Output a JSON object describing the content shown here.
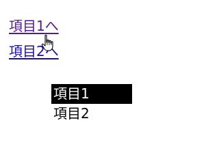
{
  "links": [
    {
      "label": "項目1へ",
      "state": "visited"
    },
    {
      "label": "項目2へ",
      "state": "unvisited"
    }
  ],
  "list": {
    "items": [
      {
        "label": "項目1",
        "selected": true
      },
      {
        "label": "項目2",
        "selected": false
      }
    ]
  },
  "colors": {
    "visited_link": "#551a8b",
    "link": "#1a0dab",
    "selected_bg": "#000000",
    "selected_fg": "#ffffff"
  },
  "icons": {
    "cursor": "hand-pointer-icon"
  }
}
